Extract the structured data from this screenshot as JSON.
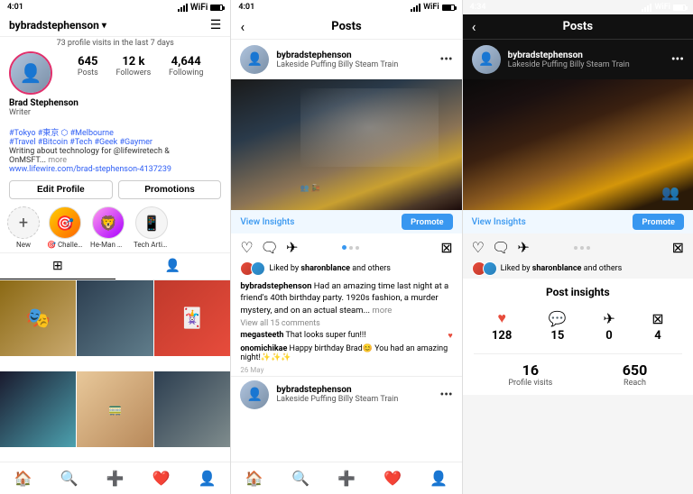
{
  "screen1": {
    "status_time": "4:01",
    "username": "bybradstephenson",
    "username_suffix": "▾",
    "menu_icon": "☰",
    "profile_visits": "73 profile visits in the last 7 days",
    "stats": [
      {
        "num": "645",
        "label": "Posts"
      },
      {
        "num": "12 k",
        "label": "Followers"
      },
      {
        "num": "4,644",
        "label": "Following"
      }
    ],
    "name": "Brad Stephenson",
    "role": "Writer",
    "tags": "#Tokyo #東京 ⬡ #Melbourne\n#Travel #Bitcoin #Tech #Geek #Gaymer",
    "about": "Writing about technology for @lifewiretech &\nOnMSFT...",
    "more": "more",
    "link": "www.lifewire.com/brad-stephenson-4137239",
    "edit_profile_btn": "Edit Profile",
    "promotions_btn": "Promotions",
    "highlights": [
      {
        "label": "New",
        "icon": "+",
        "new": true
      },
      {
        "label": "🎯 Challenge",
        "icon": "🎯"
      },
      {
        "label": "He-Man Mo...",
        "icon": "🦁"
      },
      {
        "label": "Tech Articles",
        "icon": "📱"
      }
    ],
    "bottom_nav": [
      "🏠",
      "🔍",
      "➕",
      "❤️",
      "👤"
    ]
  },
  "screen2": {
    "status_time": "4:01",
    "back_arrow": "‹",
    "title": "Posts",
    "username": "bybradstephenson",
    "location": "Lakeside Puffing Billy Steam Train",
    "view_insights": "View Insights",
    "promote": "Promote",
    "actions": [
      "♡",
      "🗨",
      "✈",
      "⊠"
    ],
    "liked_by": "Liked by ",
    "liked_name": "sharonblance",
    "liked_rest": " and others",
    "caption_user": "bybradstephenson",
    "caption": " Had an amazing time last night at a friend's 40th birthday party. 1920s fashion, a murder mystery, and on an actual steam...",
    "caption_more": "more",
    "view_comments": "View all 15 comments",
    "comments": [
      {
        "user": "megasteeth",
        "text": "That looks super fun!!!"
      },
      {
        "user": "onomichikae",
        "text": "Happy birthday Brad😊 You had an amazing night!✨✨✨"
      }
    ],
    "date": "26 May",
    "next_post_user": "bybradstephenson",
    "next_post_location": "Lakeside Puffing Billy Steam Train",
    "bottom_nav": [
      "🏠",
      "🔍",
      "➕",
      "❤️",
      "👤"
    ]
  },
  "screen3": {
    "status_time": "4:34",
    "back_arrow": "‹",
    "title": "Posts",
    "username": "bybradstephenson",
    "location": "Lakeside Puffing Billy Steam Train",
    "view_insights": "View Insights",
    "promote": "Promote",
    "post_insights_title": "Post insights",
    "metrics": [
      {
        "icon": "♥",
        "value": "128",
        "label": ""
      },
      {
        "icon": "💬",
        "value": "15",
        "label": ""
      },
      {
        "icon": "✈",
        "value": "0",
        "label": ""
      },
      {
        "icon": "⊠",
        "value": "4",
        "label": ""
      }
    ],
    "stats": [
      {
        "value": "16",
        "label": "Profile visits"
      },
      {
        "value": "650",
        "label": "Reach"
      }
    ]
  }
}
